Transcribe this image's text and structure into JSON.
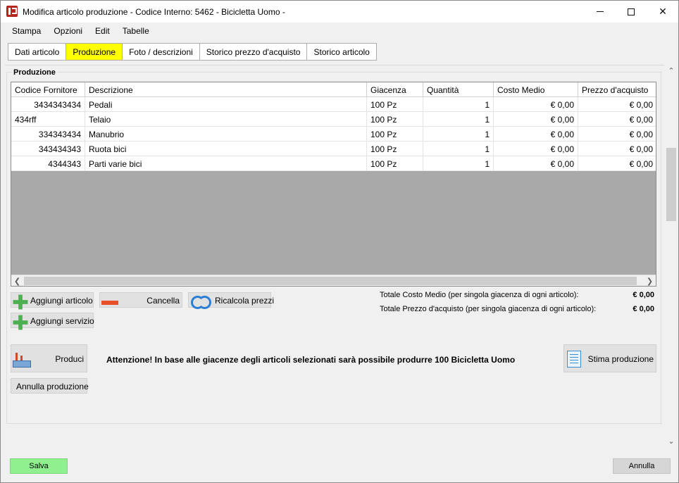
{
  "window": {
    "title": "Modifica articolo produzione - Codice Interno: 5462 - Bicicletta Uomo -"
  },
  "menu": [
    "Stampa",
    "Opzioni",
    "Edit",
    "Tabelle"
  ],
  "tabs": [
    {
      "label": "Dati articolo",
      "active": false
    },
    {
      "label": "Produzione",
      "active": true
    },
    {
      "label": "Foto / descrizioni",
      "active": false
    },
    {
      "label": "Storico prezzo d'acquisto",
      "active": false
    },
    {
      "label": "Storico articolo",
      "active": false
    }
  ],
  "group": {
    "title": "Produzione"
  },
  "table": {
    "columns": [
      "Codice Fornitore",
      "Descrizione",
      "Giacenza",
      "Quantità",
      "Costo Medio",
      "Prezzo d'acquisto"
    ],
    "rows": [
      {
        "codice": "3434343434",
        "descrizione": "Pedali",
        "giacenza": "100 Pz",
        "quantita": "1",
        "costo": "€ 0,00",
        "prezzo": "€ 0,00"
      },
      {
        "codice": "434rff",
        "descrizione": "Telaio",
        "giacenza": "100 Pz",
        "quantita": "1",
        "costo": "€ 0,00",
        "prezzo": "€ 0,00"
      },
      {
        "codice": "334343434",
        "descrizione": "Manubrio",
        "giacenza": "100 Pz",
        "quantita": "1",
        "costo": "€ 0,00",
        "prezzo": "€ 0,00"
      },
      {
        "codice": "343434343",
        "descrizione": "Ruota bici",
        "giacenza": "100 Pz",
        "quantita": "1",
        "costo": "€ 0,00",
        "prezzo": "€ 0,00"
      },
      {
        "codice": "4344343",
        "descrizione": "Parti varie bici",
        "giacenza": "100 Pz",
        "quantita": "1",
        "costo": "€ 0,00",
        "prezzo": "€ 0,00"
      }
    ]
  },
  "buttons": {
    "aggiungi_articolo": "Aggiungi articolo",
    "cancella": "Cancella",
    "ricalcola_prezzi": "Ricalcola prezzi",
    "aggiungi_servizio": "Aggiungi servizio",
    "produci": "Produci",
    "annulla_produzione": "Annulla produzione",
    "stima_produzione": "Stima produzione",
    "salva": "Salva",
    "annulla": "Annulla"
  },
  "totals": {
    "costo_medio_label": "Totale Costo Medio (per singola giacenza di ogni articolo):",
    "costo_medio_value": "€ 0,00",
    "prezzo_acquisto_label": "Totale Prezzo d'acquisto (per singola giacenza di ogni articolo):",
    "prezzo_acquisto_value": "€ 0,00"
  },
  "warning": "Attenzione! In base alle giacenze degli articoli selezionati sarà possibile produrre 100 Bicicletta Uomo",
  "colors": {
    "active_tab": "#ffff00",
    "save_button": "#90f090",
    "grid_background": "#a9a9a9"
  }
}
